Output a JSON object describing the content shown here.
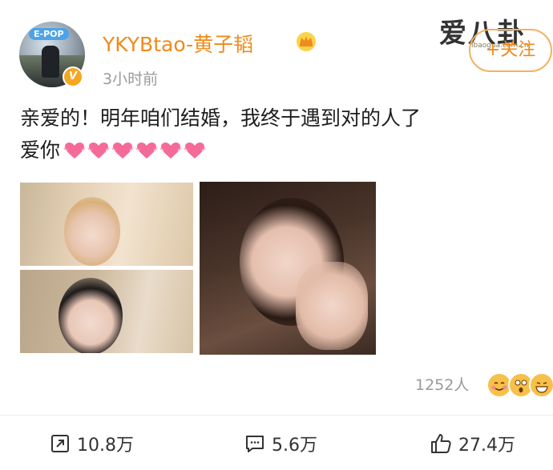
{
  "post": {
    "author": "YKYBtao-黄子韬",
    "time": "3小时前",
    "avatar_tag": "E-POP",
    "verified_badge": "V",
    "follow_label": "+关注",
    "text_line1": "亲爱的！明年咱们结婚，我终于遇到对的人了",
    "text_line2": "爱你",
    "heart_count": 6
  },
  "watermark": {
    "text": "爱八卦",
    "url": "ibaogua.com.cn"
  },
  "reactions": {
    "count_label": "1252人"
  },
  "actions": {
    "repost_count": "10.8万",
    "comment_count": "5.6万",
    "like_count": "27.4万"
  },
  "colors": {
    "username": "#f08a1a",
    "follow_border": "#f4b060",
    "meta_gray": "#9a9a9a",
    "badge": "#f5a623"
  },
  "icons": [
    "crown-icon",
    "verified-icon",
    "heart-icon",
    "repost-icon",
    "comment-icon",
    "like-icon"
  ]
}
